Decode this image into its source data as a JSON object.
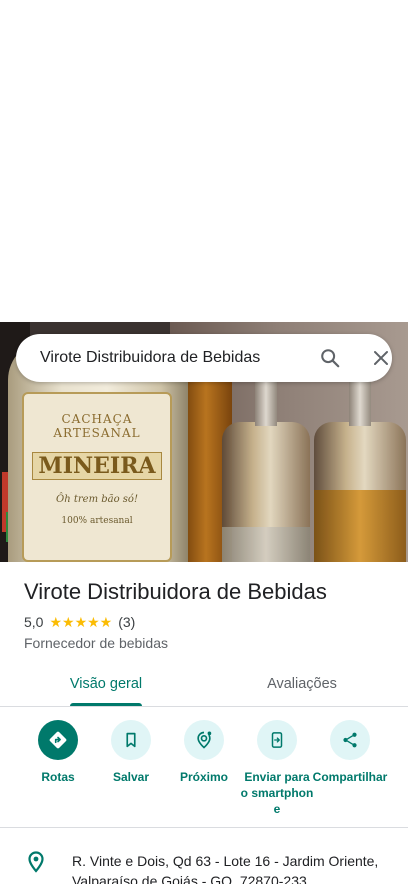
{
  "search": {
    "query": "Virote Distribuidora de Bebidas"
  },
  "hero_photo": {
    "label_line1": "CACHAÇA ARTESANAL",
    "label_line2": "MINEIRA",
    "label_line3": "Ôh trem bão só!",
    "label_line4": "100% artesanal"
  },
  "place": {
    "title": "Virote Distribuidora de Bebidas",
    "rating": "5,0",
    "stars": "★★★★★",
    "review_count": "(3)",
    "category": "Fornecedor de bebidas"
  },
  "tabs": [
    {
      "label": "Visão geral",
      "active": true
    },
    {
      "label": "Avaliações",
      "active": false
    }
  ],
  "actions": [
    {
      "label": "Rotas",
      "icon": "directions-icon"
    },
    {
      "label": "Salvar",
      "icon": "bookmark-icon"
    },
    {
      "label": "Próximo",
      "icon": "nearby-icon"
    },
    {
      "label": "Enviar para o smartphone",
      "icon": "send-to-phone-icon"
    },
    {
      "label": "Compartilhar",
      "icon": "share-icon"
    }
  ],
  "address": {
    "text": "R. Vinte e Dois, Qd 63 - Lote 16 - Jardim Oriente, Valparaíso de Goiás - GO, 72870-233"
  },
  "colors": {
    "accent": "#00796b",
    "accent_light": "#e0f5f6",
    "star": "#fbbc04"
  }
}
